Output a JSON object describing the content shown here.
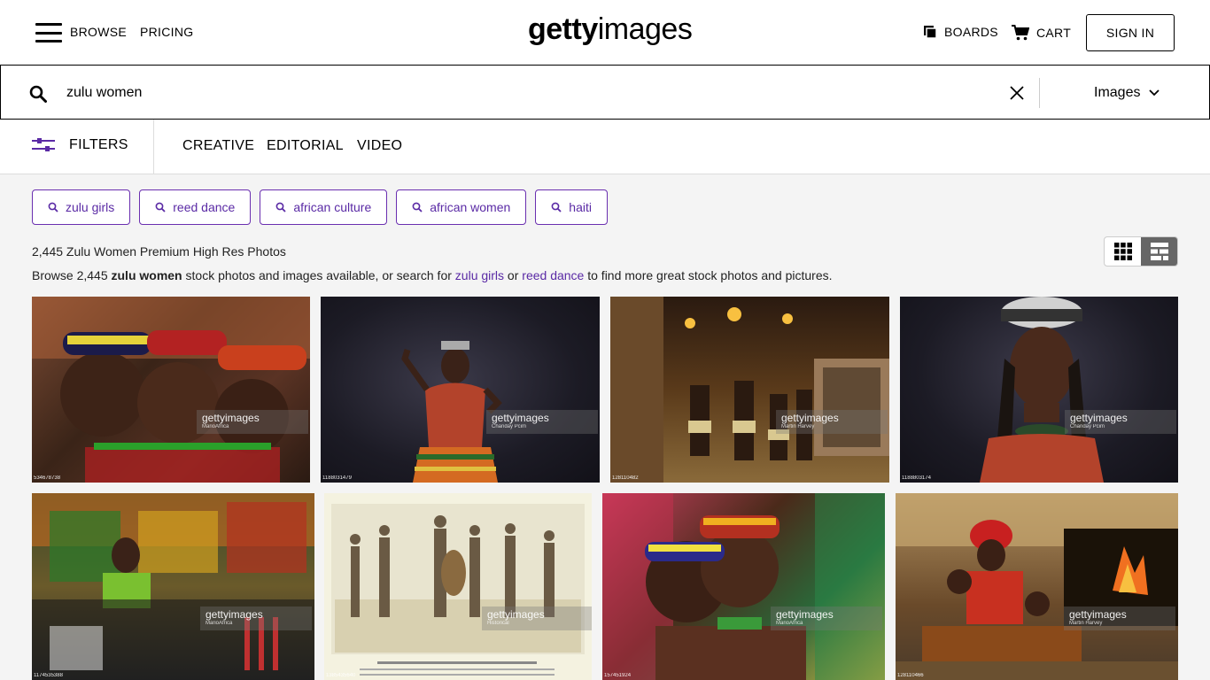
{
  "header": {
    "browse": "BROWSE",
    "pricing": "PRICING",
    "logo_bold": "getty",
    "logo_light": "images",
    "boards": "BOARDS",
    "cart": "CART",
    "sign_in": "SIGN IN"
  },
  "search": {
    "query": "zulu women",
    "type": "Images"
  },
  "filterbar": {
    "filters": "FILTERS",
    "tabs": [
      "CREATIVE",
      "EDITORIAL",
      "VIDEO"
    ]
  },
  "related": [
    "zulu girls",
    "reed dance",
    "african culture",
    "african women",
    "haiti"
  ],
  "results": {
    "count": "2,445 Zulu Women Premium High Res Photos",
    "desc_pre": "Browse 2,445 ",
    "desc_bold": "zulu women",
    "desc_mid": " stock photos and images available, or search for ",
    "link1": "zulu girls",
    "desc_or": " or ",
    "link2": "reed dance",
    "desc_post": " to find more great stock photos and pictures."
  },
  "images": [
    {
      "credit": "MarioAfrica",
      "id": "534678738",
      "theme": "warm"
    },
    {
      "credit": "Chanday Pcim",
      "id": "1188031479",
      "theme": "dark"
    },
    {
      "credit": "Martin Harvey",
      "id": "128110482",
      "theme": "night"
    },
    {
      "credit": "Chanday Pcim",
      "id": "1188803174",
      "theme": "dark"
    },
    {
      "credit": "MarioAfrica",
      "id": "1174535388",
      "theme": "bead"
    },
    {
      "credit": "Historical",
      "id": "1385435640",
      "theme": "sketch"
    },
    {
      "credit": "MarioAfrica",
      "id": "157451924",
      "theme": "bead2"
    },
    {
      "credit": "Martin Harvey",
      "id": "128110466",
      "theme": "hut"
    }
  ],
  "watermark": "gettyimages"
}
